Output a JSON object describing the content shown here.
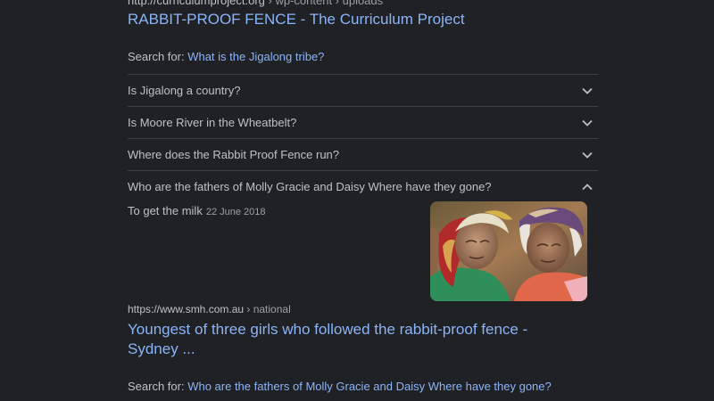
{
  "result1": {
    "cite_domain": "http://curriculumproject.org",
    "cite_path": " › wp-content › uploads",
    "title": "RABBIT-PROOF FENCE - The Curriculum Project"
  },
  "search_for_1": {
    "label": "Search for: ",
    "query": "What is the Jigalong tribe?"
  },
  "people_also_ask": [
    {
      "question": "Is Jigalong a country?",
      "expanded": false
    },
    {
      "question": "Is Moore River in the Wheatbelt?",
      "expanded": false
    },
    {
      "question": "Where does the Rabbit Proof Fence run?",
      "expanded": false
    },
    {
      "question": "Who are the fathers of Molly Gracie and Daisy Where have they gone?",
      "expanded": true
    }
  ],
  "expanded_answer": {
    "text": "To get the milk",
    "date": "22 June 2018"
  },
  "result2": {
    "cite_domain": "https://www.smh.com.au",
    "cite_path": " › national",
    "title": "Youngest of three girls who followed the rabbit-proof fence - Sydney ..."
  },
  "search_for_2": {
    "label": "Search for: ",
    "query": "Who are the fathers of Molly Gracie and Daisy Where have they gone?"
  },
  "colors": {
    "background": "#202124",
    "link": "#8ab4f8",
    "text": "#bdc1c6",
    "divider": "#3c4043"
  }
}
